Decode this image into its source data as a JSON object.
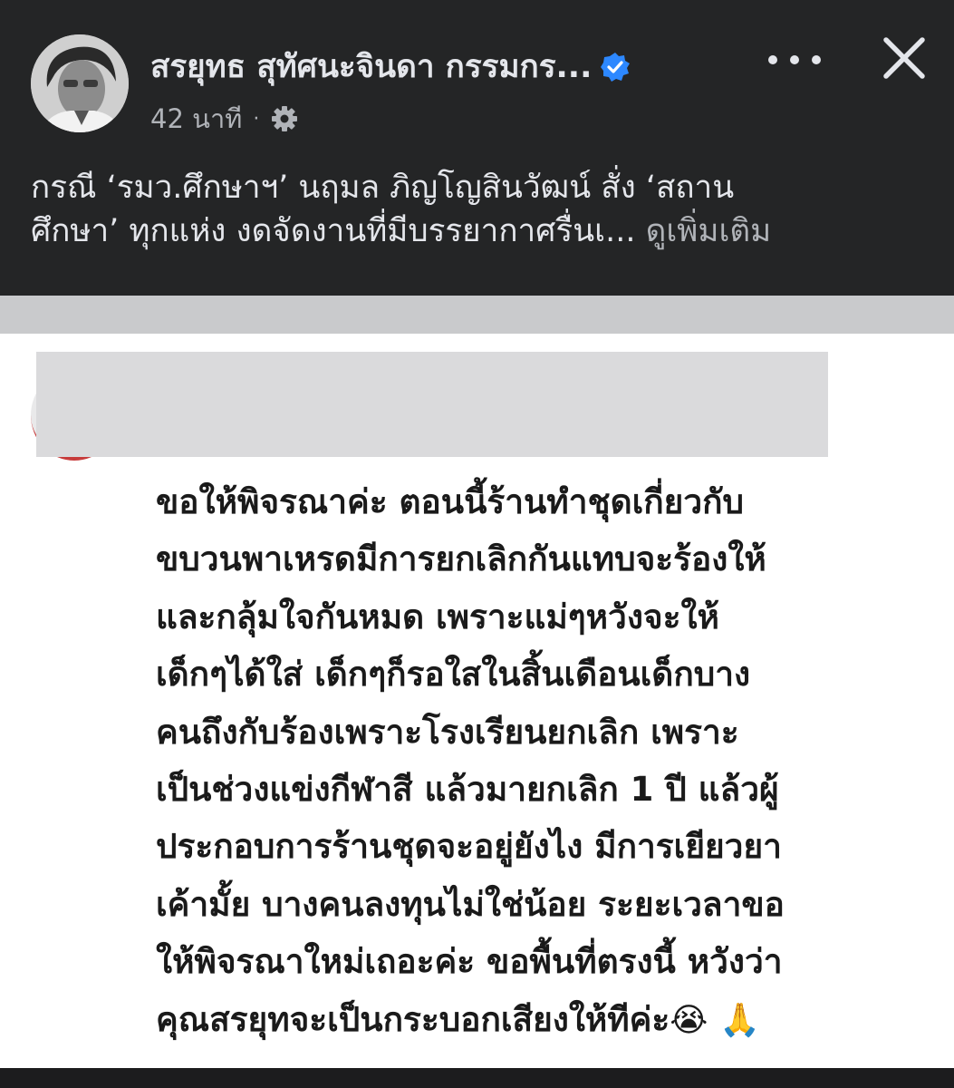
{
  "post": {
    "author_name": "สรยุทธ สุทัศนะจินดา กรรมกร...",
    "timestamp": "42 นาที",
    "separator_dot": "·",
    "text_lines": [
      "กรณี ‘รมว.ศึกษาฯ’ นฤมล ภิญโญสินวัฒน์ สั่ง ‘สถาน",
      "ศึกษา’ ทุกแห่ง งดจัดงานที่มีบรรยากาศรื่นเ..."
    ],
    "see_more_label": "ดูเพิ่มเติม",
    "icons": {
      "verified": "verified-badge-icon",
      "audience": "gear-icon",
      "more": "more-options-icon",
      "close": "close-icon"
    }
  },
  "comment": {
    "lines": [
      "ขอให้พิจรณาค่ะ ตอนนี้ร้านทำชุดเกี่ยวกับ",
      "ขบวนพาเหรดมีการยกเลิกกันแทบจะร้องให้",
      "และกลุ้มใจกันหมด เพราะแม่ๆหวังจะให้",
      "เด็กๆได้ใส่ เด็กๆก็รอใสในสิ้นเดือนเด็กบาง",
      "คนถึงกับร้องเพราะโรงเรียนยกเลิก เพราะ",
      "เป็นช่วงแข่งกีฬาสี แล้วมายกเลิก 1 ปี แล้วผู้",
      "ประกอบการร้านชุดจะอยู่ยังไง มีการเยียวยา",
      "เค้ามั้ย บางคนลงทุนไม่ใช่น้อย ระยะเวลาขอ",
      "ให้พิจรณาใหม่เถอะค่ะ ขอพื้นที่ตรงนี้ หวังว่า",
      "คุณสรยุทจะเป็นกระบอกเสียงให้ทีค่ะ"
    ],
    "emojis": [
      "😭",
      "🙏"
    ]
  },
  "colors": {
    "header_bg": "#242526",
    "header_text": "#e4e6eb",
    "muted_text": "#b0b3b8",
    "verified_blue": "#2d88ff",
    "separator": "#c9cacc"
  }
}
